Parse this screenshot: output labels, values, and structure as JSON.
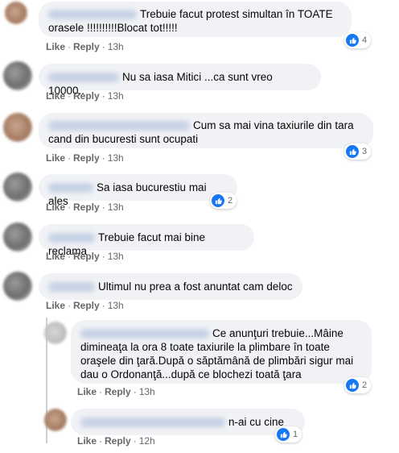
{
  "comments": [
    {
      "text_line1": "Trebuie facut protest simultan în TOATE",
      "text_line2": "orasele !!!!!!!!!!Blocat tot!!!!!",
      "likes": "4",
      "actions": {
        "like": "Like",
        "reply": "Reply",
        "time": "13h"
      }
    },
    {
      "text": "Nu sa iasa Mitici ...ca sunt vreo 10000..",
      "actions": {
        "like": "Like",
        "reply": "Reply",
        "time": "13h"
      }
    },
    {
      "text_line1": "Cum sa mai vina taxiurile din tara",
      "text_line2": "cand din bucuresti sunt ocupati",
      "likes": "3",
      "actions": {
        "like": "Like",
        "reply": "Reply",
        "time": "13h"
      }
    },
    {
      "text": "Sa iasa bucurestiu mai ales",
      "likes": "2",
      "actions": {
        "like": "Like",
        "reply": "Reply",
        "time": "13h"
      }
    },
    {
      "text": "Trebuie facut mai bine reclama",
      "actions": {
        "like": "Like",
        "reply": "Reply",
        "time": "13h"
      }
    },
    {
      "text": "Ultimul nu prea a fost anuntat cam deloc",
      "actions": {
        "like": "Like",
        "reply": "Reply",
        "time": "13h"
      }
    }
  ],
  "replies": [
    {
      "text_line1": "Ce anunţuri trebuie...Mâine",
      "text_line2": "dimineaţa la ora 8 toate taxiurile la plimbare în toate",
      "text_line3": "oraşele din ţară.După o săptămână de plimbări sigur mai",
      "text_line4": "dau o Ordonanţă...după ce blochezi toată ţara",
      "likes": "2",
      "actions": {
        "like": "Like",
        "reply": "Reply",
        "time": "13h"
      }
    },
    {
      "text": "n-ai cu cine",
      "likes": "1",
      "actions": {
        "like": "Like",
        "reply": "Reply",
        "time": "12h"
      }
    }
  ]
}
